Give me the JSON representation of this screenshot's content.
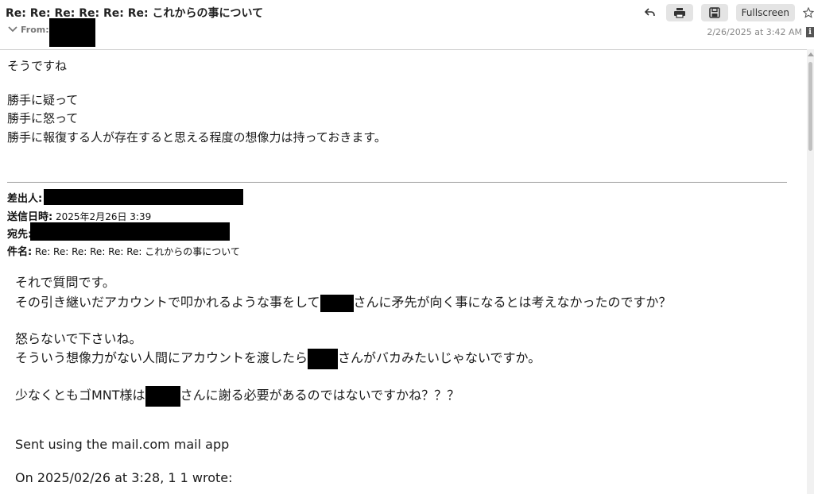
{
  "header": {
    "subject": "Re: Re: Re: Re: Re: Re: これからの事について",
    "from_label": "From:",
    "date": "2/26/2025 at 3:42 AM",
    "fullscreen_label": "Fullscreen",
    "info_label": "i",
    "icons": [
      "reply-icon",
      "print-icon",
      "save-icon",
      "star-icon",
      "chevron-down-icon"
    ]
  },
  "reply": {
    "line1": "そうですね",
    "line2": "勝手に疑って",
    "line3": "勝手に怒って",
    "line4": "勝手に報復する人が存在すると思える程度の想像力は持っておきます。"
  },
  "meta": {
    "sender_label": "差出人:",
    "sent_label": "送信日時:",
    "sent_value": " 2025年2月26日 3:39",
    "to_label": "宛先:",
    "subject_label": "件名:",
    "subject_value": " Re: Re: Re: Re: Re: Re: これからの事について"
  },
  "quoted": {
    "l1": "それで質問です。",
    "l2a": "その引き継いだアカウントで叩かれるような事をして",
    "l2b": "さんに矛先が向く事になるとは考えなかったのですか？",
    "l3": "怒らないで下さいね。",
    "l4a": "そういう想像力がない人間にアカウントを渡したら",
    "l4b": "さんがバカみたいじゃないですか。",
    "l5a": "少なくともゴMNT様は",
    "l5b": "さんに謝る必要があるのではないですかね？？？",
    "l6": "Sent using the mail.com mail app",
    "l7": "On 2025/02/26 at 3:28, 1 1 wrote:"
  }
}
